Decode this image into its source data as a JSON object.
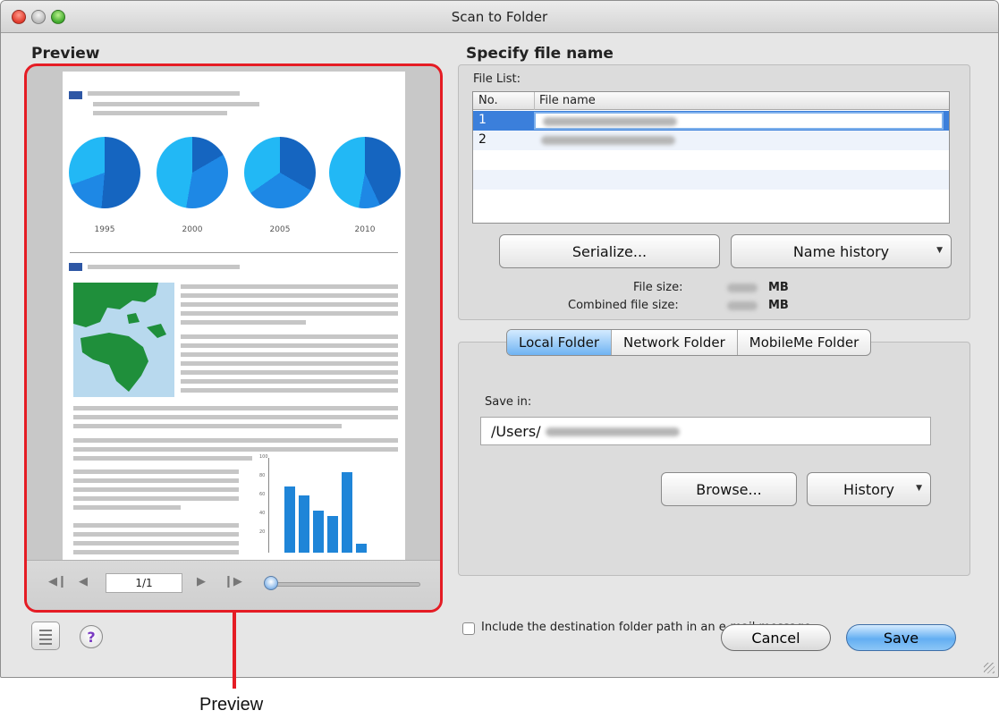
{
  "window": {
    "title": "Scan to Folder"
  },
  "preview": {
    "section_title": "Preview",
    "page_indicator": "1/1",
    "chart_years": [
      "1995",
      "2000",
      "2005",
      "2010"
    ],
    "bar_axis_ticks": [
      "100",
      "80",
      "60",
      "40",
      "20"
    ],
    "zoom_level": 0.0
  },
  "file_name": {
    "section_title": "Specify file name",
    "file_list_label": "File List:",
    "columns": {
      "no": "No.",
      "name": "File name"
    },
    "rows": [
      {
        "no": "1"
      },
      {
        "no": "2"
      }
    ],
    "serialize_label": "Serialize...",
    "name_history_label": "Name history",
    "file_size_label": "File size:",
    "combined_size_label": "Combined file size:",
    "size_unit": "MB"
  },
  "destination": {
    "tabs": [
      "Local Folder",
      "Network Folder",
      "MobileMe Folder"
    ],
    "active_tab": "Local Folder",
    "save_in_label": "Save in:",
    "save_in_value": "/Users/",
    "browse_label": "Browse...",
    "history_label": "History"
  },
  "include_path_label": "Include the destination folder path in an e-mail message",
  "buttons": {
    "cancel": "Cancel",
    "save": "Save",
    "help": "?"
  },
  "callout": {
    "label": "Preview"
  },
  "colors": {
    "callout": "#e51c24",
    "accent": "#4a90e2",
    "selected_row": "#3b7fdb"
  }
}
